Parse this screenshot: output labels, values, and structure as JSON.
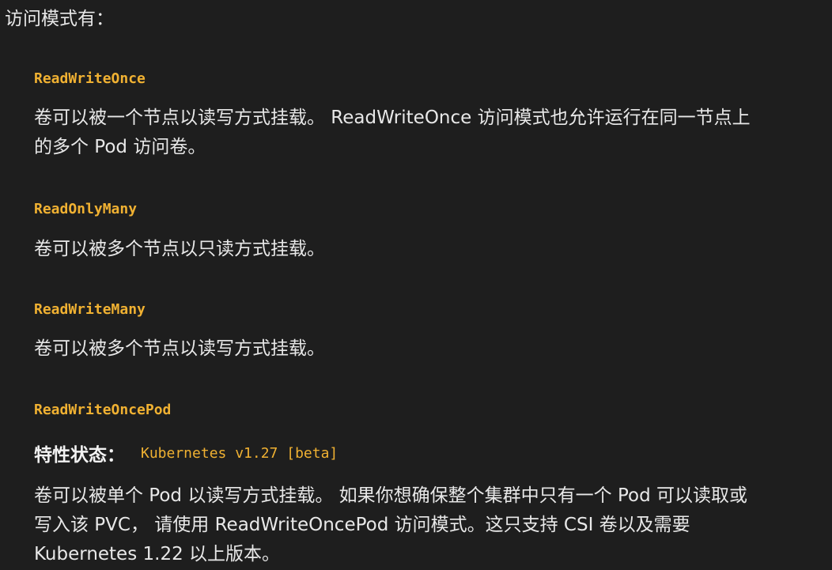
{
  "intro": "访问模式有：",
  "modes": [
    {
      "term": "ReadWriteOnce",
      "description_lines": [
        "卷可以被一个节点以读写方式挂载。 ReadWriteOnce 访问模式也允许运行在同一节点上",
        "的多个 Pod 访问卷。"
      ]
    },
    {
      "term": "ReadOnlyMany",
      "description_lines": [
        "卷可以被多个节点以只读方式挂载。"
      ]
    },
    {
      "term": "ReadWriteMany",
      "description_lines": [
        "卷可以被多个节点以读写方式挂载。"
      ]
    },
    {
      "term": "ReadWriteOncePod",
      "feature_state": {
        "label": "特性状态：",
        "value": "Kubernetes v1.27 [beta]"
      },
      "description_lines": [
        "卷可以被单个 Pod 以读写方式挂载。 如果你想确保整个集群中只有一个 Pod 可以读取或",
        "写入该 PVC， 请使用 ReadWriteOncePod 访问模式。这只支持 CSI 卷以及需要",
        "Kubernetes 1.22 以上版本。"
      ]
    }
  ]
}
